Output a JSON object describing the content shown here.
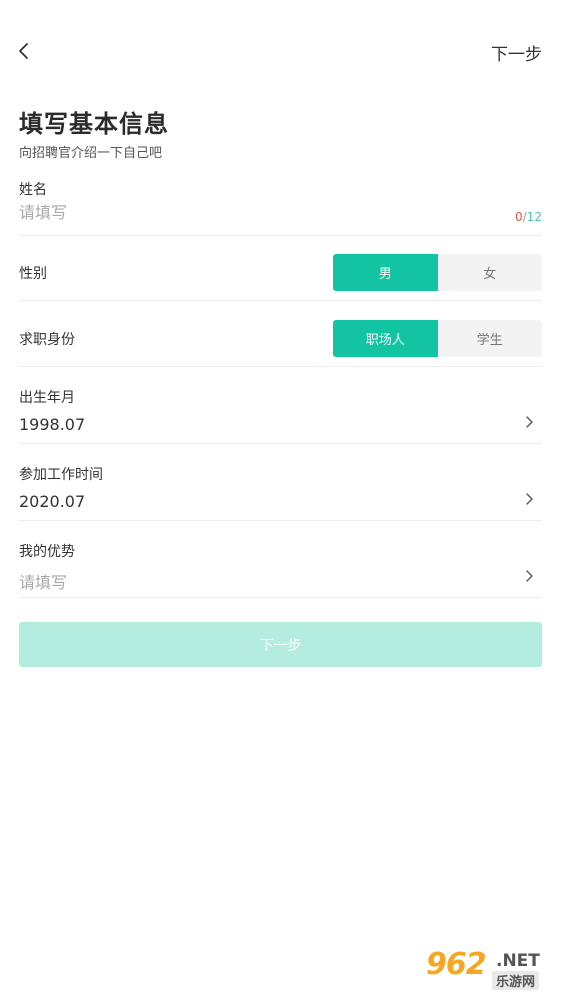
{
  "header": {
    "back_icon": "chevron-left-icon",
    "next_label": "下一步"
  },
  "intro": {
    "title": "填写基本信息",
    "subtitle": "向招聘官介绍一下自己吧"
  },
  "name_field": {
    "label": "姓名",
    "placeholder": "请填写",
    "value": "",
    "count_current": "0",
    "count_separator": "/",
    "count_max": "12"
  },
  "gender": {
    "label": "性别",
    "options": [
      "男",
      "女"
    ],
    "selected": "男"
  },
  "identity": {
    "label": "求职身份",
    "options": [
      "职场人",
      "学生"
    ],
    "selected": "职场人"
  },
  "birth": {
    "label": "出生年月",
    "value": "1998.07"
  },
  "work_start": {
    "label": "参加工作时间",
    "value": "2020.07"
  },
  "strengths": {
    "label": "我的优势",
    "placeholder": "请填写"
  },
  "submit": {
    "label": "下一步"
  },
  "watermark": {
    "number": "962",
    "net": ".NET",
    "cn": "乐游网"
  },
  "colors": {
    "accent": "#12c4a1",
    "submit_disabled": "#b4ece0",
    "counter_current": "#e05a4a",
    "counter_max": "#4fc0b0"
  }
}
